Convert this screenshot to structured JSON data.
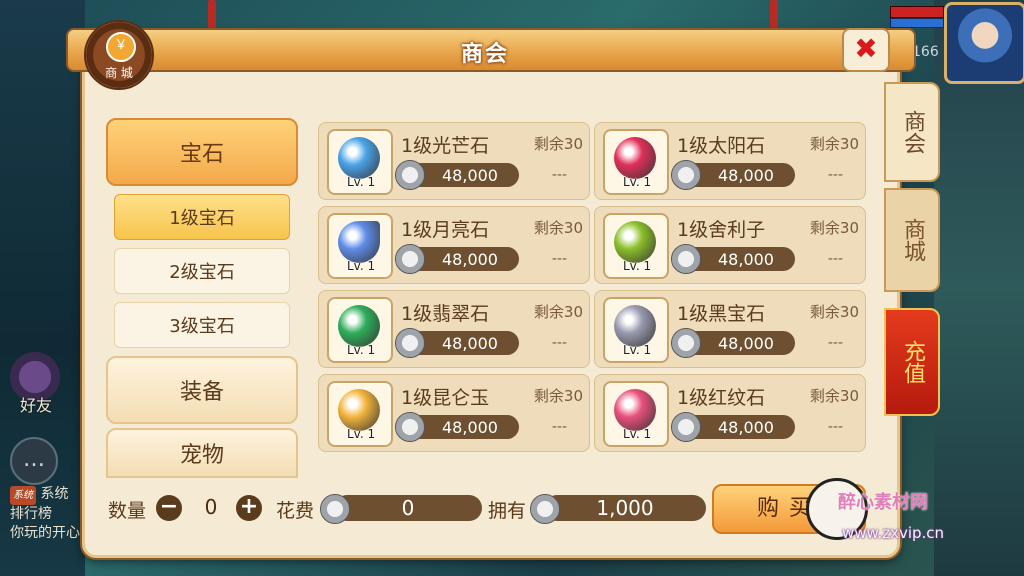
{
  "window": {
    "title": "商会"
  },
  "badge": {
    "coin_symbol": "￥",
    "label": "商 城"
  },
  "close_icon": "✖",
  "right_tabs": [
    {
      "label": "商会"
    },
    {
      "label": "商城"
    },
    {
      "label": "充值"
    }
  ],
  "categories": {
    "gem": "宝石",
    "gem_sub": [
      "1级宝石",
      "2级宝石",
      "3级宝石"
    ],
    "equip": "装备",
    "pet": "宠物"
  },
  "items": [
    {
      "name": "1级光芒石",
      "level": "Lv. 1",
      "remain": "剩余30",
      "price": "48,000",
      "extra": "---",
      "color": "#4aa3e8"
    },
    {
      "name": "1级太阳石",
      "level": "Lv. 1",
      "remain": "剩余30",
      "price": "48,000",
      "extra": "---",
      "color": "#e0305a"
    },
    {
      "name": "1级月亮石",
      "level": "Lv. 1",
      "remain": "剩余30",
      "price": "48,000",
      "extra": "---",
      "color": "#5f8de8"
    },
    {
      "name": "1级舍利子",
      "level": "Lv. 1",
      "remain": "剩余30",
      "price": "48,000",
      "extra": "---",
      "color": "#8cbf2a"
    },
    {
      "name": "1级翡翠石",
      "level": "Lv. 1",
      "remain": "剩余30",
      "price": "48,000",
      "extra": "---",
      "color": "#2fae5a"
    },
    {
      "name": "1级黑宝石",
      "level": "Lv. 1",
      "remain": "剩余30",
      "price": "48,000",
      "extra": "---",
      "color": "#9a9ab0"
    },
    {
      "name": "1级昆仑玉",
      "level": "Lv. 1",
      "remain": "剩余30",
      "price": "48,000",
      "extra": "---",
      "color": "#f2b43c"
    },
    {
      "name": "1级红纹石",
      "level": "Lv. 1",
      "remain": "剩余30",
      "price": "48,000",
      "extra": "---",
      "color": "#e8507a"
    }
  ],
  "bottom": {
    "qty_label": "数量",
    "qty_value": "0",
    "minus": "−",
    "plus": "+",
    "cost_label": "花费",
    "cost_value": "0",
    "own_label": "拥有",
    "own_value": "1,000",
    "buy_label": "购买"
  },
  "hud": {
    "friend_label": "好友",
    "level_number": "166",
    "chat_lines": [
      "系统",
      "排行榜",
      "你玩的开心"
    ],
    "chat_tag": "系统"
  },
  "watermark": {
    "text": "醉心素材网",
    "url": "www.zxvip.cn"
  }
}
